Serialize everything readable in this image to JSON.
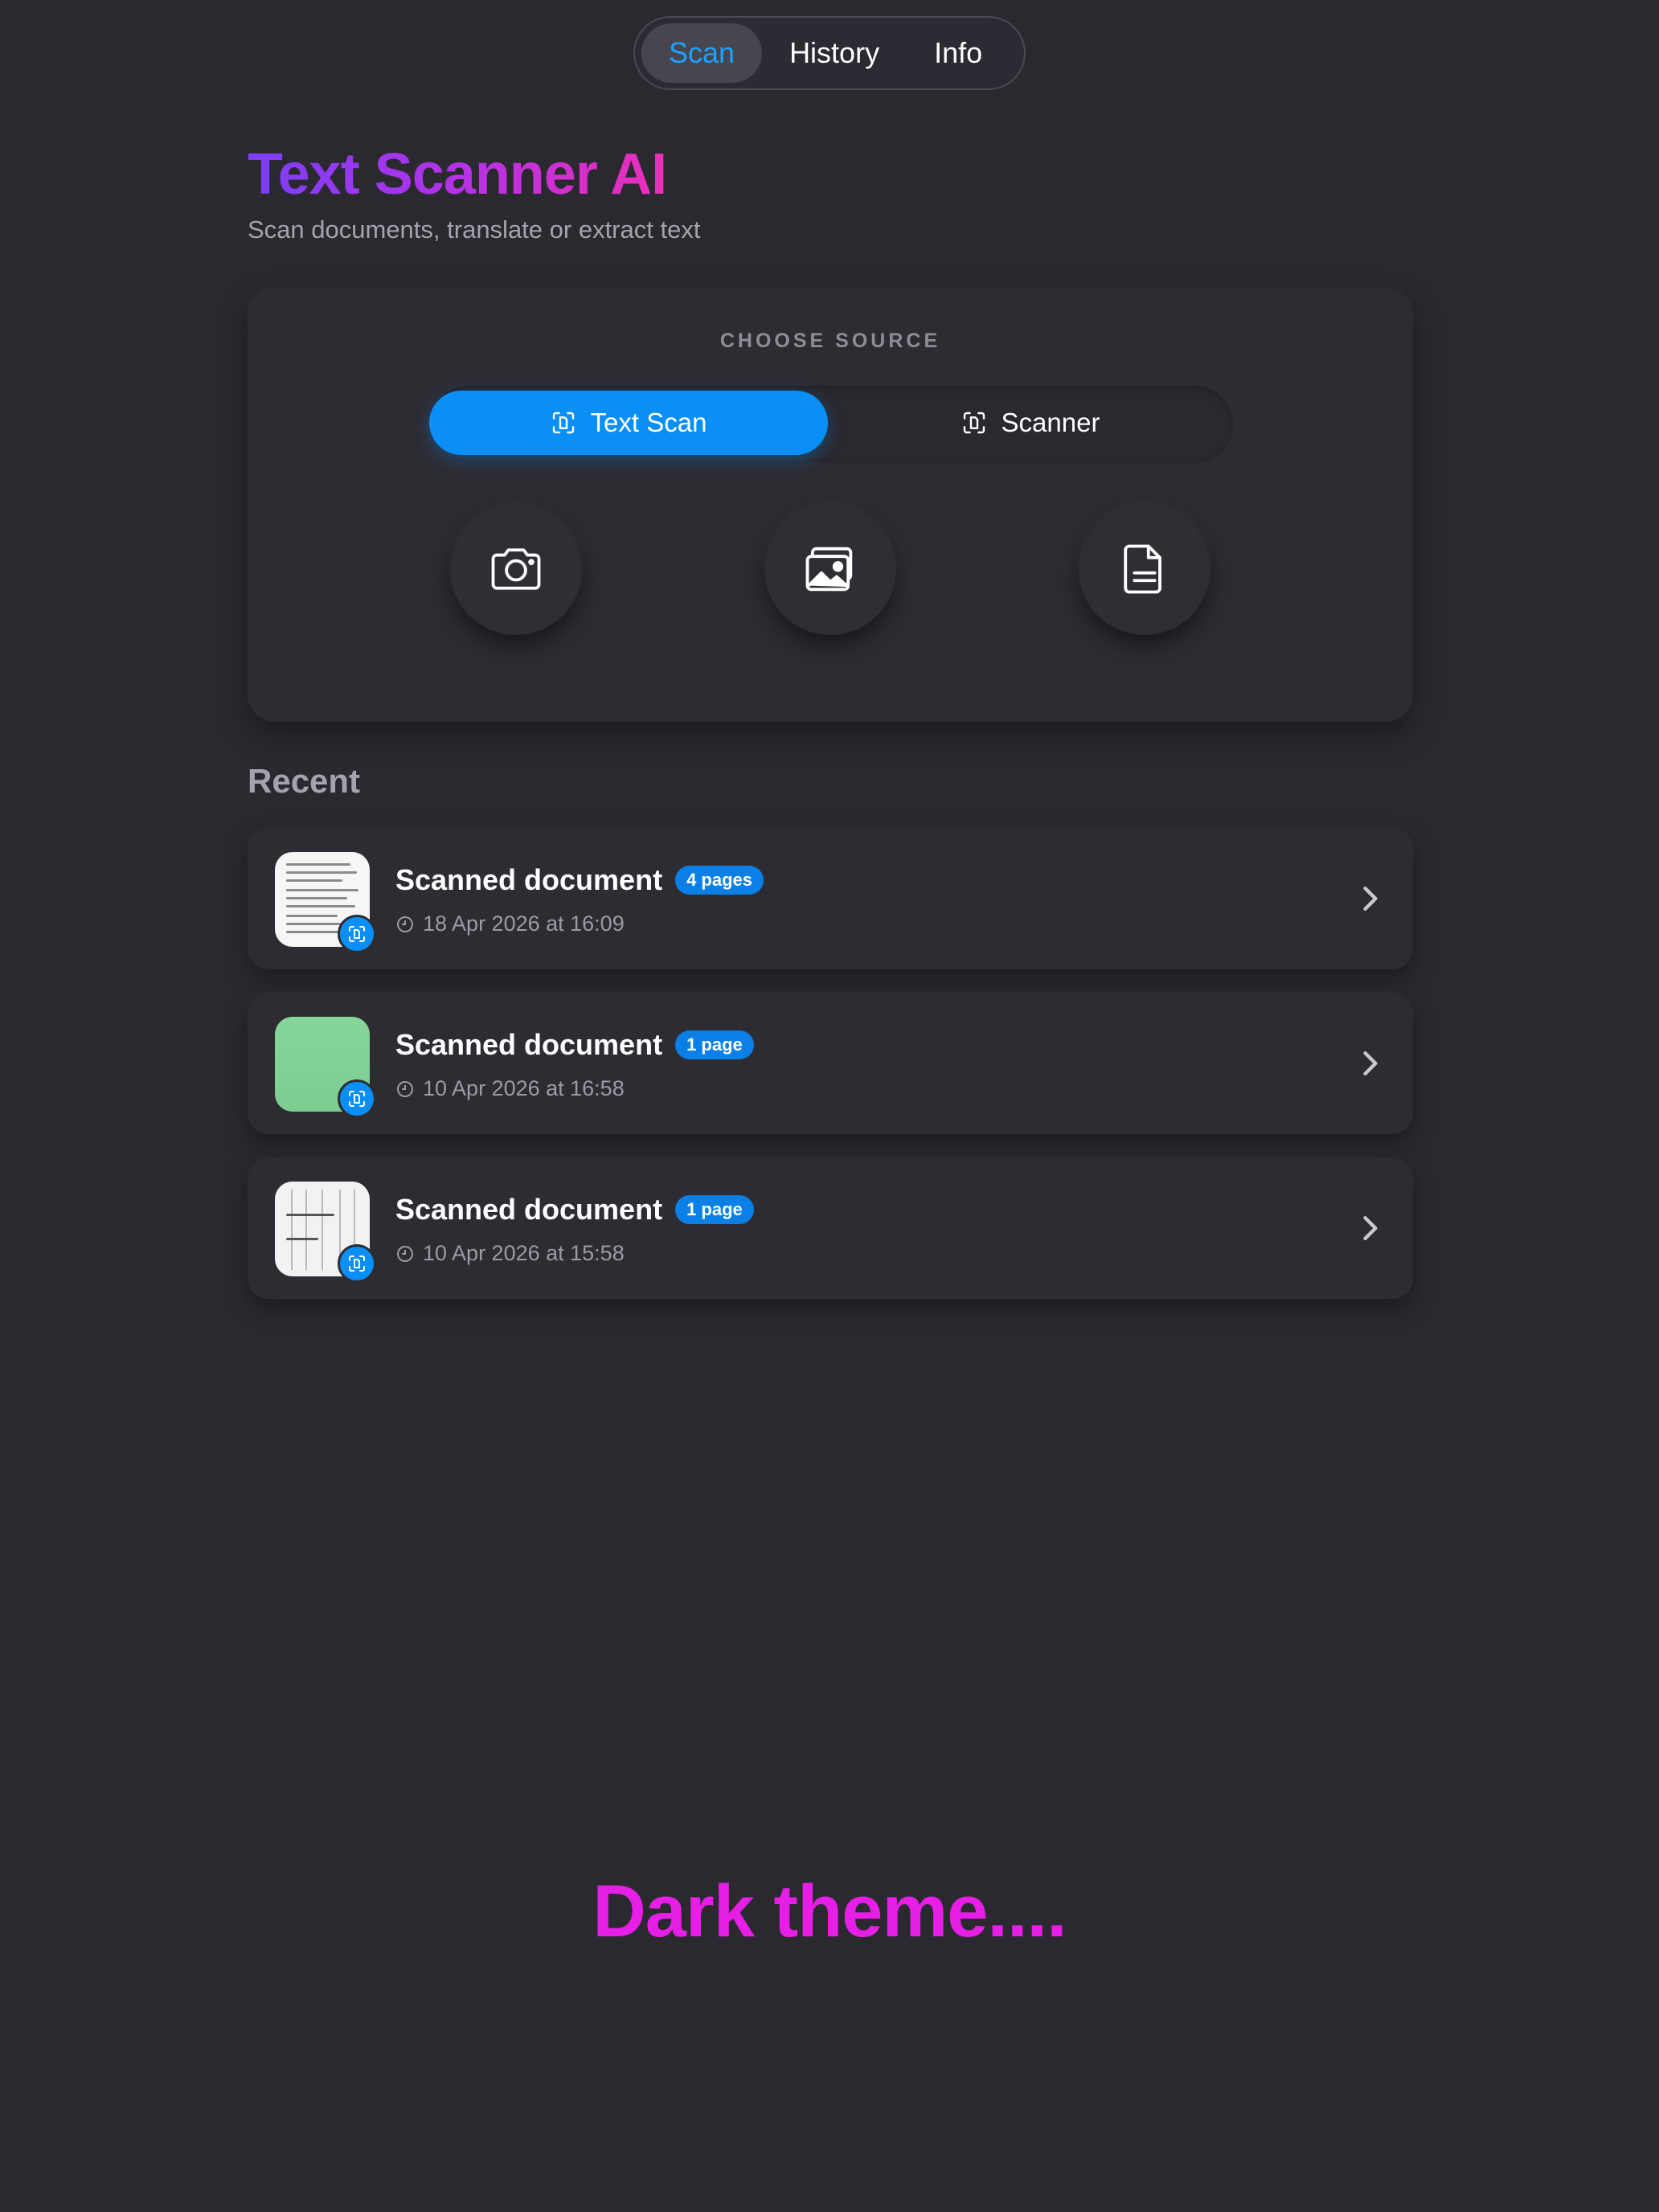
{
  "nav": {
    "tabs": [
      {
        "label": "Scan",
        "active": true
      },
      {
        "label": "History",
        "active": false
      },
      {
        "label": "Info",
        "active": false
      }
    ]
  },
  "header": {
    "title": "Text Scanner AI",
    "subtitle": "Scan documents, translate or extract text"
  },
  "source": {
    "label": "CHOOSE SOURCE",
    "modes": [
      {
        "label": "Text Scan",
        "selected": true,
        "icon": "text-scan-icon"
      },
      {
        "label": "Scanner",
        "selected": false,
        "icon": "scanner-icon"
      }
    ],
    "buttons": [
      {
        "icon": "camera-icon"
      },
      {
        "icon": "photo-library-icon"
      },
      {
        "icon": "document-file-icon"
      }
    ]
  },
  "recent": {
    "title": "Recent",
    "items": [
      {
        "title": "Scanned document",
        "pages": "4 pages",
        "date": "18 Apr 2026 at 16:09"
      },
      {
        "title": "Scanned document",
        "pages": "1 page",
        "date": "10 Apr 2026 at 16:58"
      },
      {
        "title": "Scanned document",
        "pages": "1 page",
        "date": "10 Apr 2026 at 15:58"
      }
    ]
  },
  "footer": {
    "note": "Dark theme...."
  },
  "colors": {
    "background": "#2a2930",
    "accent": "#0a8ff7",
    "active_tab_text": "#1aa3ff",
    "title_gradient_start": "#7b3ff5",
    "title_gradient_end": "#ec2fb8",
    "footer_text": "#e61ee6"
  }
}
